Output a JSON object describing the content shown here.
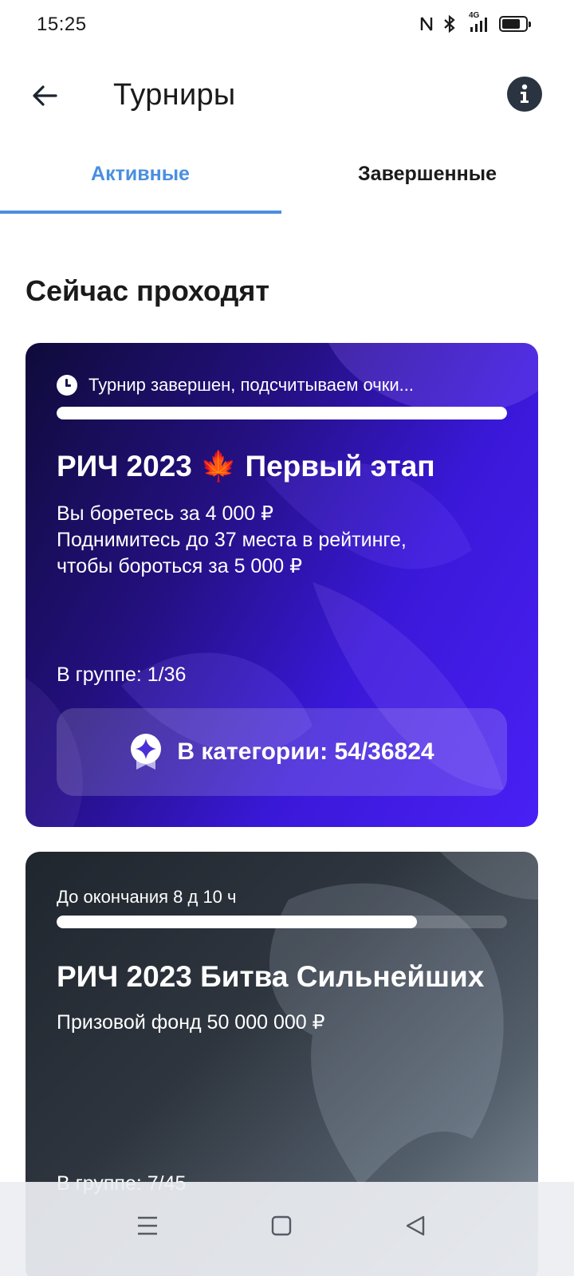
{
  "status_bar": {
    "time": "15:25",
    "network": "4G"
  },
  "header": {
    "title": "Турниры"
  },
  "tabs": [
    {
      "label": "Активные",
      "active": true
    },
    {
      "label": "Завершенные",
      "active": false
    }
  ],
  "section": {
    "title": "Сейчас проходят"
  },
  "cards": [
    {
      "status": "Турнир завершен, подсчитываем очки...",
      "progress": 1.0,
      "title": "РИЧ 2023 🍁 Первый этап",
      "desc_lines": [
        "Вы боретесь за 4 000 ₽",
        "Поднимитесь до 37 места в рейтинге,",
        "чтобы бороться за 5 000 ₽"
      ],
      "group_rank": "В группе: 1/36",
      "category_rank": "В категории: 54/36824"
    },
    {
      "status": "До окончания 8 д 10 ч",
      "progress": 0.8,
      "title": "РИЧ 2023 Битва Сильнейших",
      "desc_lines": [
        "Призовой фонд 50 000 000 ₽"
      ],
      "group_rank": "В группе: 7/45"
    }
  ],
  "colors": {
    "accent": "#4a8fe0",
    "card1_end": "#4a20f5",
    "card2_base": "#2e353e"
  },
  "icons": [
    "back-arrow-icon",
    "info-icon",
    "clock-icon",
    "badge-star-icon",
    "menu-icon",
    "home-square-icon",
    "back-triangle-icon"
  ]
}
